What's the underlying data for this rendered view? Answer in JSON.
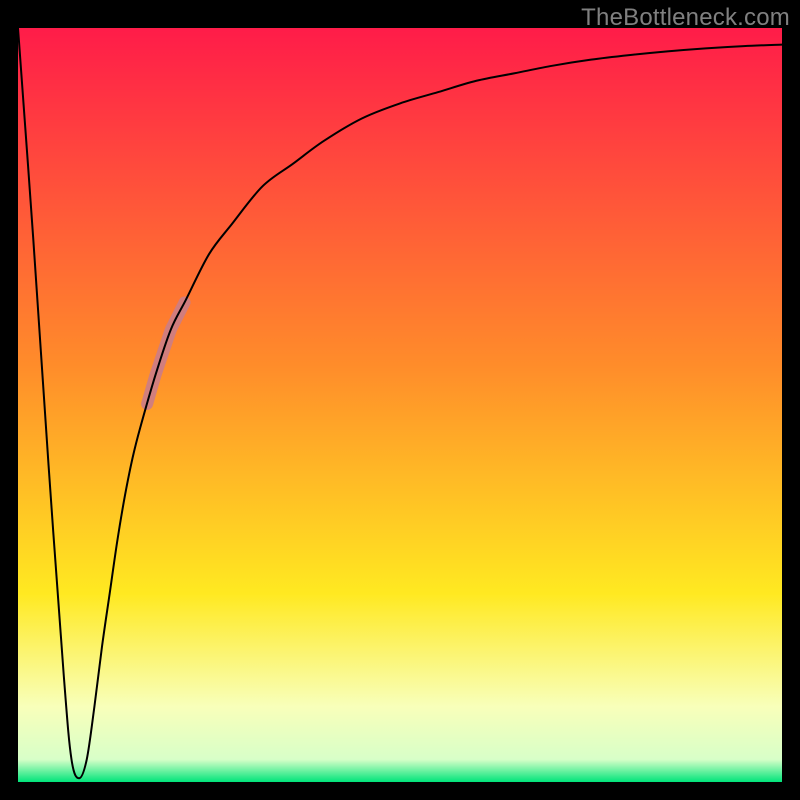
{
  "watermark": "TheBottleneck.com",
  "colors": {
    "frame": "#000000",
    "watermark": "#808080",
    "curve": "#000000",
    "marker": "#cf7d82",
    "gradient_top": "#ff1c49",
    "gradient_mid1": "#ff8d2a",
    "gradient_mid2": "#ffe921",
    "gradient_band_light": "#f8ffba",
    "gradient_bottom": "#00e47a"
  },
  "chart_data": {
    "type": "line",
    "title": "",
    "xlabel": "",
    "ylabel": "",
    "xlim": [
      0,
      100
    ],
    "ylim": [
      0,
      100
    ],
    "grid": false,
    "legend": false,
    "series": [
      {
        "name": "bottleneck-curve",
        "x": [
          0,
          2,
          4,
          6,
          7,
          8,
          9,
          10,
          11,
          12,
          13,
          14,
          15,
          16,
          18,
          20,
          22,
          25,
          28,
          32,
          36,
          40,
          45,
          50,
          55,
          60,
          65,
          70,
          75,
          80,
          85,
          90,
          95,
          100
        ],
        "y": [
          100,
          72,
          42,
          14,
          3,
          0.5,
          3,
          10,
          18,
          25,
          32,
          38,
          43,
          47,
          54,
          60,
          64,
          70,
          74,
          79,
          82,
          85,
          88,
          90,
          91.5,
          93,
          94,
          95,
          95.8,
          96.4,
          96.9,
          97.3,
          97.6,
          97.8
        ]
      }
    ],
    "markers": [
      {
        "name": "highlight-segment-upper",
        "x_range": [
          18.3,
          21.8
        ],
        "stroke_width": 12
      },
      {
        "name": "highlight-segment-lower",
        "x_range": [
          16.9,
          18.2
        ],
        "stroke_width": 12
      }
    ],
    "background_gradient": {
      "stops": [
        {
          "offset": 0.0,
          "color": "#ff1c49"
        },
        {
          "offset": 0.45,
          "color": "#ff8d2a"
        },
        {
          "offset": 0.75,
          "color": "#ffe921"
        },
        {
          "offset": 0.9,
          "color": "#f8ffba"
        },
        {
          "offset": 0.97,
          "color": "#d8ffc8"
        },
        {
          "offset": 1.0,
          "color": "#00e47a"
        }
      ]
    }
  }
}
